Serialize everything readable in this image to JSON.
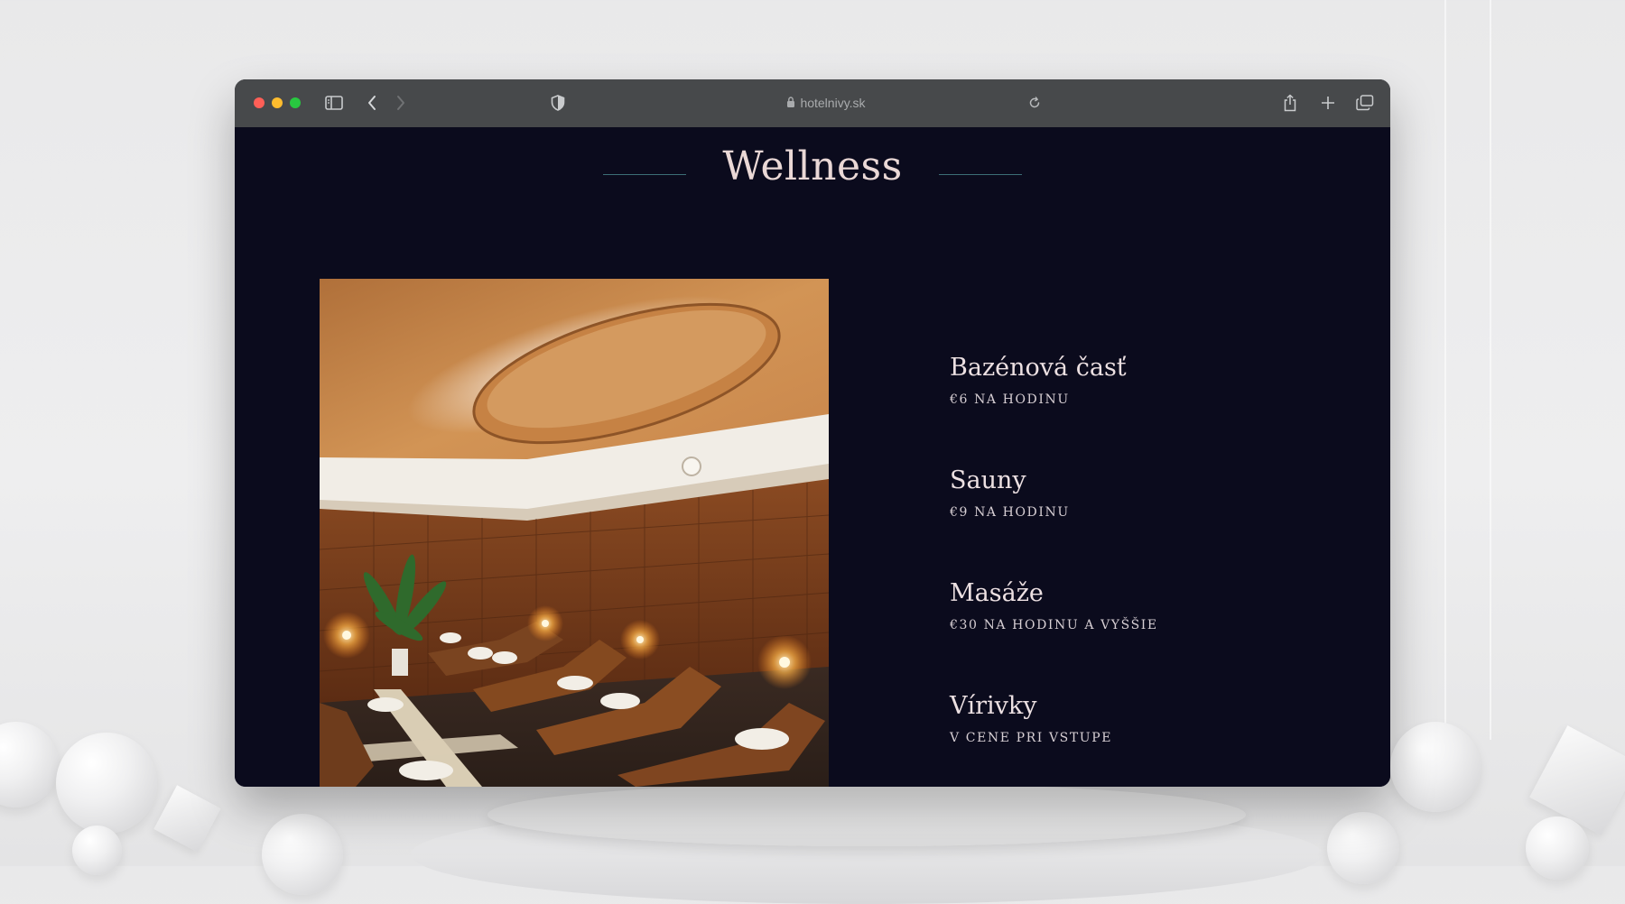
{
  "browser": {
    "url": "hotelnivy.sk",
    "icons": [
      "sidebar-icon",
      "back-icon",
      "forward-icon",
      "privacy-shield-icon",
      "lock-icon",
      "reload-icon",
      "share-icon",
      "new-tab-icon",
      "tabs-overview-icon"
    ]
  },
  "page": {
    "title": "Wellness",
    "services": [
      {
        "name": "Bazénová časť",
        "price": "€6 NA HODINU"
      },
      {
        "name": "Sauny",
        "price": "€9 NA HODINU"
      },
      {
        "name": "Masáže",
        "price": "€30 NA HODINU A VYŠŠIE"
      },
      {
        "name": "Vírivky",
        "price": "V CENE PRI VSTUPE"
      }
    ]
  },
  "colors": {
    "page_background": "#0b0b1d",
    "title": "#ead8d6",
    "accent_line": "#3c6f77",
    "toolbar": "#47494b"
  }
}
